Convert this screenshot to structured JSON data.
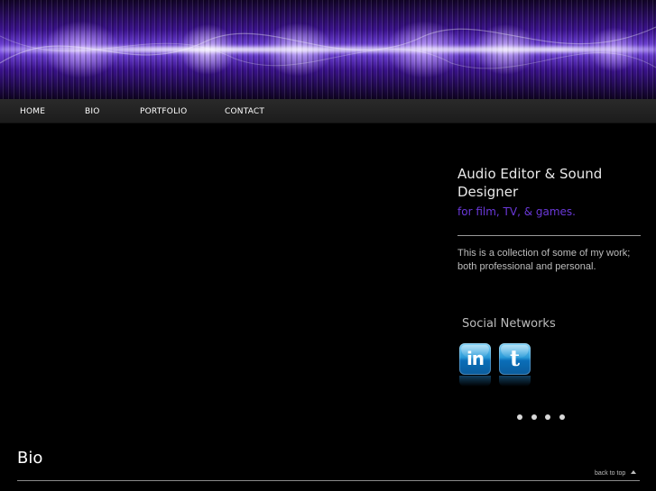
{
  "nav": {
    "items": [
      {
        "label": "HOME"
      },
      {
        "label": "BIO"
      },
      {
        "label": "PORTFOLIO"
      },
      {
        "label": "CONTACT"
      }
    ]
  },
  "intro": {
    "headline": "Audio Editor & Sound Designer",
    "subheadline": "for film, TV, & games.",
    "description": "This is a collection of some of my work; both professional and personal."
  },
  "social": {
    "heading": "Social Networks",
    "icons": [
      {
        "name": "linkedin-icon",
        "glyph": "in"
      },
      {
        "name": "twitter-icon",
        "glyph": "t"
      }
    ]
  },
  "slider": {
    "dot_count": 4
  },
  "bio": {
    "title": "Bio",
    "back_to_top": "back to top"
  },
  "colors": {
    "accent": "#6a38d8",
    "background": "#000000",
    "nav_bg": "#222222"
  }
}
